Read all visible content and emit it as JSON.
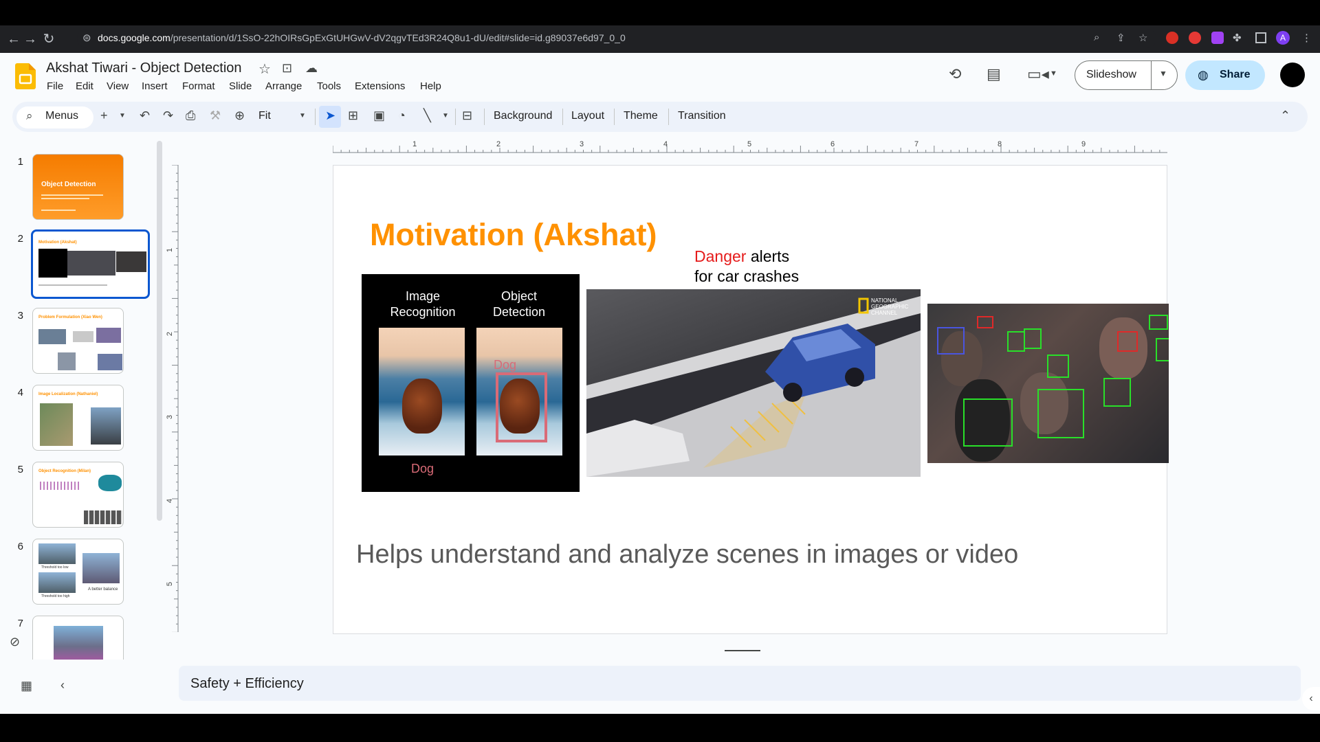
{
  "browser": {
    "url_host": "docs.google.com",
    "url_path": "/presentation/d/1SsO-22hOIRsGpExGtUHGwV-dV2qgvTEd3R24Q8u1-dU/edit#slide=id.g89037e6d97_0_0"
  },
  "app": {
    "title": "Akshat Tiwari - Object Detection",
    "menu": [
      "File",
      "Edit",
      "View",
      "Insert",
      "Format",
      "Slide",
      "Arrange",
      "Tools",
      "Extensions",
      "Help"
    ],
    "slideshow_label": "Slideshow",
    "share_label": "Share",
    "profile_initial": "A"
  },
  "toolbar": {
    "search_label": "Menus",
    "zoom_label": "Fit",
    "background_label": "Background",
    "layout_label": "Layout",
    "theme_label": "Theme",
    "transition_label": "Transition"
  },
  "ruler": {
    "h_numbers": [
      "1",
      "2",
      "3",
      "4",
      "5",
      "6",
      "7",
      "8",
      "9"
    ],
    "v_numbers": [
      "1",
      "2",
      "3",
      "4",
      "5"
    ]
  },
  "filmstrip": {
    "slide_numbers": [
      "1",
      "2",
      "3",
      "4",
      "5",
      "6",
      "7"
    ],
    "thumb1_title": "Object Detection",
    "thumb2_title": "Motivation (Akshat)",
    "thumb3_title": "Problem Formulation (Xiao Wen)",
    "thumb4_title": "Image Localization (Nathaniel)",
    "thumb5_title": "Object Recognition (Milan)",
    "thumb6_caption": "A better balance",
    "thumb6_low": "Threshold too low",
    "thumb6_high": "Threshold too high"
  },
  "slide": {
    "title": "Motivation (Akshat)",
    "danger_word": "Danger",
    "danger_rest": " alerts",
    "danger_line2": "for car crashes",
    "panel_left_head": "Image Recognition",
    "panel_right_head": "Object Detection",
    "dog_label": "Dog",
    "box_label": "Dog",
    "natgeo_label": "NATIONAL GEOGRAPHIC CHANNEL",
    "subtitle": "Helps understand and analyze scenes in images or video"
  },
  "notes": {
    "text": "Safety + Efficiency"
  },
  "colors": {
    "accent_orange": "#ff9100",
    "share_bg": "#c2e7ff",
    "selected_border": "#0b57d0",
    "danger_red": "#e51b1b"
  }
}
